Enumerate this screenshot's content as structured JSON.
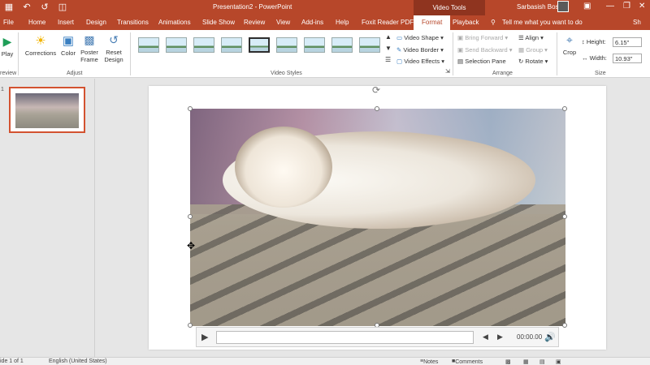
{
  "titlebar": {
    "document_title": "Presentation2 - PowerPoint",
    "context_group": "Video Tools",
    "user_name": "Sarbasish Bose",
    "minimize": "—",
    "restore": "❐",
    "close": "✕"
  },
  "tabs": [
    "File",
    "Home",
    "Insert",
    "Design",
    "Transitions",
    "Animations",
    "Slide Show",
    "Review",
    "View",
    "Add-ins",
    "Help",
    "Foxit Reader PDF",
    "Format",
    "Playback"
  ],
  "tell_me": "Tell me what you want to do",
  "share": "Sh",
  "ribbon": {
    "preview": {
      "play_label": "Play",
      "group": "review"
    },
    "adjust": {
      "corrections": "Corrections",
      "color": "Color",
      "poster_frame_1": "Poster",
      "poster_frame_2": "Frame",
      "reset_design_1": "Reset",
      "reset_design_2": "Design",
      "group": "Adjust"
    },
    "video_styles": {
      "video_shape": "Video Shape",
      "video_border": "Video Border",
      "video_effects": "Video Effects",
      "group": "Video Styles"
    },
    "arrange": {
      "bring_forward": "Bring Forward",
      "send_backward": "Send Backward",
      "selection_pane": "Selection Pane",
      "align": "Align",
      "group_btn": "Group",
      "rotate": "Rotate",
      "group": "Arrange"
    },
    "size": {
      "crop": "Crop",
      "height_label": "Height:",
      "height_value": "6.15\"",
      "width_label": "Width:",
      "width_value": "10.93\"",
      "group": "Size"
    }
  },
  "player": {
    "time": "00:00.00"
  },
  "status": {
    "slide": "ide 1 of 1",
    "language": "English (United States)",
    "notes": "Notes",
    "comments": "Comments"
  },
  "colors": {
    "accent": "#b7472a",
    "context_tab": "#8f341f",
    "thumb_border": "#d35230"
  }
}
